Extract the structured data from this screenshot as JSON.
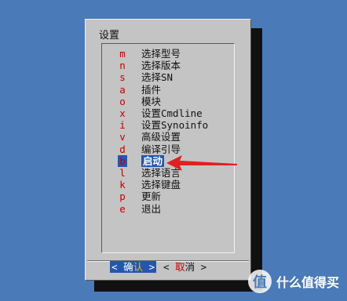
{
  "dialog": {
    "title": "设置"
  },
  "menu": {
    "items": [
      {
        "key": "m",
        "label": "选择型号"
      },
      {
        "key": "n",
        "label": "选择版本"
      },
      {
        "key": "s",
        "label": "选择SN"
      },
      {
        "key": "a",
        "label": "插件"
      },
      {
        "key": "o",
        "label": "模块"
      },
      {
        "key": "x",
        "label": "设置Cmdline"
      },
      {
        "key": "i",
        "label": "设置Synoinfo"
      },
      {
        "key": "v",
        "label": "高级设置"
      },
      {
        "key": "d",
        "label": "编译引导"
      },
      {
        "key": "b",
        "label": "启动",
        "selected": true
      },
      {
        "key": "l",
        "label": "选择语言"
      },
      {
        "key": "k",
        "label": "选择键盘"
      },
      {
        "key": "p",
        "label": "更新"
      },
      {
        "key": "e",
        "label": "退出"
      }
    ]
  },
  "buttons": {
    "ok": {
      "left": "<",
      "first": "确",
      "accel": "认",
      "right": ">"
    },
    "cancel": {
      "left": "<",
      "accel": "取",
      "rest": "消",
      "right": ">"
    }
  },
  "annotation": {
    "arrow_color": "#e02020"
  },
  "watermark": {
    "logo_glyph": "值",
    "text": "什么值得买"
  },
  "colors": {
    "background": "#4a7ab8",
    "dialog": "#c4c4c4",
    "selection": "#2456b0",
    "hotkey": "#c00000"
  }
}
